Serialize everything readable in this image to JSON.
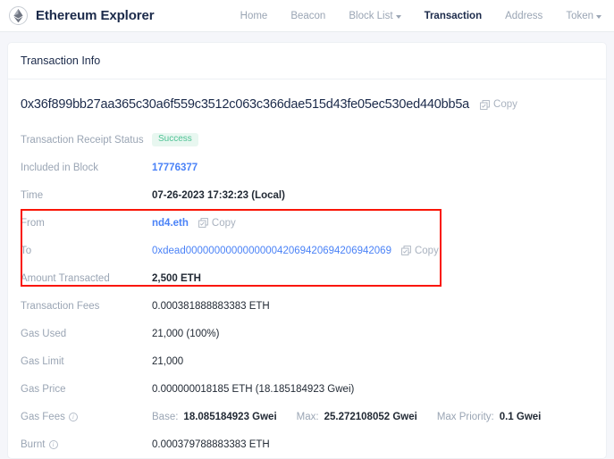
{
  "navbar": {
    "brand": "Ethereum Explorer",
    "logo_icon": "ethereum-diamond-icon",
    "links": [
      {
        "label": "Home",
        "active": false,
        "caret": false
      },
      {
        "label": "Beacon",
        "active": false,
        "caret": false
      },
      {
        "label": "Block List",
        "active": false,
        "caret": true
      },
      {
        "label": "Transaction",
        "active": true,
        "caret": false
      },
      {
        "label": "Address",
        "active": false,
        "caret": false
      },
      {
        "label": "Token",
        "active": false,
        "caret": true
      }
    ]
  },
  "card": {
    "header": "Transaction Info"
  },
  "transaction": {
    "hash": "0x36f899bb27aa365c30a6f559c3512c063c366dae515d43fe05ec530ed440bb5a",
    "copy_label": "Copy",
    "copy_icon": "copy-icon"
  },
  "rows": {
    "receipt_status": {
      "label": "Transaction Receipt Status",
      "value": "Success"
    },
    "included_in_block": {
      "label": "Included in Block",
      "value": "17776377"
    },
    "time": {
      "label": "Time",
      "value": "07-26-2023 17:32:23 (Local)"
    },
    "from": {
      "label": "From",
      "value": "nd4.eth",
      "copy_label": "Copy"
    },
    "to": {
      "label": "To",
      "value": "0xdead000000000000000042069420694206942069",
      "copy_label": "Copy"
    },
    "amount_transacted": {
      "label": "Amount Transacted",
      "value": "2,500 ETH"
    },
    "transaction_fees": {
      "label": "Transaction Fees",
      "value": "0.000381888883383 ETH"
    },
    "gas_used": {
      "label": "Gas Used",
      "value": "21,000 (100%)"
    },
    "gas_limit": {
      "label": "Gas Limit",
      "value": "21,000"
    },
    "gas_price": {
      "label": "Gas Price",
      "value": "0.000000018185 ETH (18.185184923 Gwei)"
    },
    "gas_fees": {
      "label": "Gas Fees",
      "base_key": "Base:",
      "base_value": "18.085184923 Gwei",
      "max_key": "Max:",
      "max_value": "25.272108052 Gwei",
      "max_priority_key": "Max Priority:",
      "max_priority_value": "0.1 Gwei"
    },
    "burnt": {
      "label": "Burnt",
      "value": "0.000379788883383 ETH"
    }
  },
  "colors": {
    "brand_dark": "#1b2a4a",
    "link_blue": "#4a82f7",
    "muted": "#9aa5b4",
    "success_text": "#4ec294",
    "success_bg": "#e8f7f0",
    "highlight_border": "#fa1505",
    "page_bg": "#f5f6fa"
  }
}
